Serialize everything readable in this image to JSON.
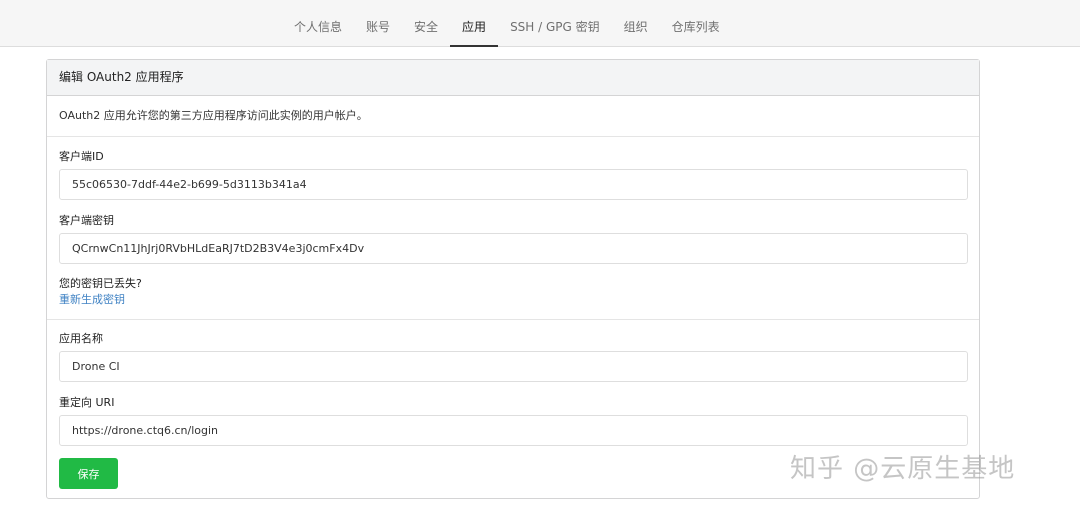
{
  "nav": {
    "tabs": [
      {
        "label": "个人信息",
        "active": false
      },
      {
        "label": "账号",
        "active": false
      },
      {
        "label": "安全",
        "active": false
      },
      {
        "label": "应用",
        "active": true
      },
      {
        "label": "SSH / GPG 密钥",
        "active": false
      },
      {
        "label": "组织",
        "active": false
      },
      {
        "label": "仓库列表",
        "active": false
      }
    ]
  },
  "panel": {
    "title": "编辑 OAuth2 应用程序",
    "description": "OAuth2 应用允许您的第三方应用程序访问此实例的用户帐户。",
    "client_id": {
      "label": "客户端ID",
      "value": "55c06530-7ddf-44e2-b699-5d3113b341a4"
    },
    "client_secret": {
      "label": "客户端密钥",
      "value": "QCrnwCn11JhJrj0RVbHLdEaRJ7tD2B3V4e3j0cmFx4Dv"
    },
    "lost_secret_text": "您的密钥已丢失?",
    "regenerate_link": "重新生成密钥",
    "app_name": {
      "label": "应用名称",
      "value": "Drone CI"
    },
    "redirect_uri": {
      "label": "重定向 URI",
      "value": "https://drone.ctq6.cn/login"
    },
    "save_label": "保存"
  },
  "watermark": "知乎 @云原生基地",
  "colors": {
    "primary_green": "#21ba45",
    "link_blue": "#4183c4",
    "header_bg": "#f3f4f5"
  }
}
